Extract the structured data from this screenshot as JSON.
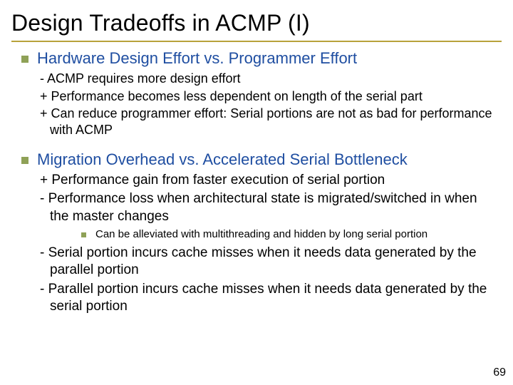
{
  "title": "Design Tradeoffs in ACMP (I)",
  "sections": [
    {
      "heading": "Hardware Design Effort vs. Programmer Effort",
      "items": [
        "- ACMP requires more design effort",
        "+ Performance becomes less dependent on length of the serial part",
        "+ Can reduce programmer effort: Serial portions are not as bad for performance with ACMP"
      ]
    },
    {
      "heading": "Migration Overhead vs. Accelerated Serial Bottleneck",
      "items_a": [
        "+ Performance gain from faster execution of serial portion",
        "- Performance loss when architectural state is migrated/switched in when the master changes"
      ],
      "subnote": "Can be alleviated with multithreading and hidden by long serial portion",
      "items_b": [
        "- Serial portion incurs cache misses when it needs data generated by the parallel portion",
        "- Parallel portion incurs cache misses when it needs data generated by the serial portion"
      ]
    }
  ],
  "page_number": "69"
}
